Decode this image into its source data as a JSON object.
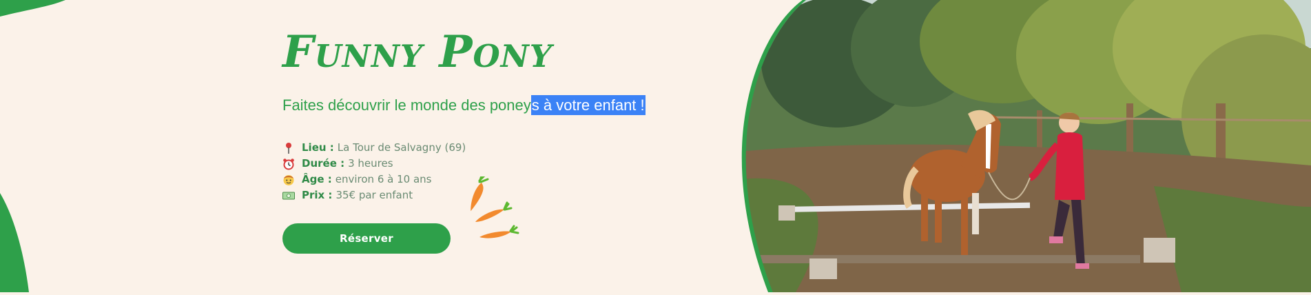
{
  "hero": {
    "title": "Funny Pony",
    "subtitle_normal": "Faites découvrir le monde des poney",
    "subtitle_selected": "s à votre enfant !"
  },
  "info": [
    {
      "icon": "pin-icon",
      "label": "Lieu :",
      "value": "La Tour de Salvagny (69)"
    },
    {
      "icon": "alarm-clock-icon",
      "label": "Durée :",
      "value": "3 heures"
    },
    {
      "icon": "child-face-icon",
      "label": "Âge :",
      "value": "environ 6 à 10 ans"
    },
    {
      "icon": "banknote-icon",
      "label": "Prix :",
      "value": "35€ par enfant"
    }
  ],
  "cta": {
    "label": "Réserver"
  },
  "colors": {
    "background": "#fbf2e9",
    "brand_green": "#2ea04a",
    "selection": "#3b82f6"
  }
}
